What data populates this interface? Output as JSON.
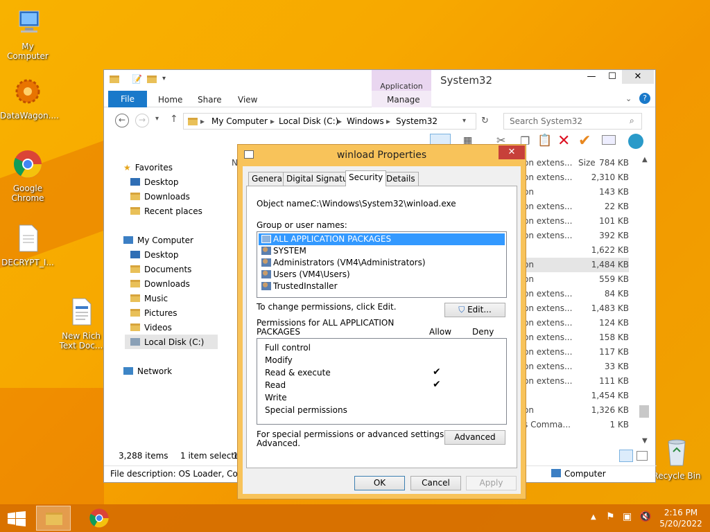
{
  "desktop": {
    "icons": [
      {
        "label": "My Computer"
      },
      {
        "label": "DataWagon...."
      },
      {
        "label": "Google Chrome"
      },
      {
        "label": "DECRYPT_I..."
      },
      {
        "label": "New Rich Text Doc..."
      },
      {
        "label": "Recycle Bin"
      }
    ]
  },
  "explorer": {
    "title": "System32",
    "context_tab": "Application Tools",
    "ribbon_tabs": [
      "File",
      "Home",
      "Share",
      "View",
      "Manage"
    ],
    "address": [
      "My Computer",
      "Local Disk (C:)",
      "Windows",
      "System32"
    ],
    "search_placeholder": "Search System32",
    "column_size": "Size",
    "nav": {
      "favorites": "Favorites",
      "fav_items": [
        "Desktop",
        "Downloads",
        "Recent places"
      ],
      "computer": "My Computer",
      "computer_items": [
        "Desktop",
        "Documents",
        "Downloads",
        "Music",
        "Pictures",
        "Videos",
        "Local Disk (C:)"
      ],
      "network": "Network"
    },
    "rows": [
      {
        "type": "on extens...",
        "size": "784 KB"
      },
      {
        "type": "on extens...",
        "size": "2,310 KB"
      },
      {
        "type": "on",
        "size": "143 KB"
      },
      {
        "type": "on extens...",
        "size": "22 KB"
      },
      {
        "type": "on extens...",
        "size": "101 KB"
      },
      {
        "type": "on extens...",
        "size": "392 KB"
      },
      {
        "type": "",
        "size": "1,622 KB"
      },
      {
        "type": "on",
        "size": "1,484 KB"
      },
      {
        "type": "on",
        "size": "559 KB"
      },
      {
        "type": "on extens...",
        "size": "84 KB"
      },
      {
        "type": "on extens...",
        "size": "1,483 KB"
      },
      {
        "type": "on extens...",
        "size": "124 KB"
      },
      {
        "type": "on extens...",
        "size": "158 KB"
      },
      {
        "type": "on extens...",
        "size": "117 KB"
      },
      {
        "type": "on extens...",
        "size": "33 KB"
      },
      {
        "type": "on extens...",
        "size": "111 KB"
      },
      {
        "type": "",
        "size": "1,454 KB"
      },
      {
        "type": "on",
        "size": "1,326 KB"
      },
      {
        "type": "s Comma...",
        "size": "1 KB"
      }
    ],
    "status_items": "3,288 items",
    "status_selected": "1 item selected",
    "status_selected_tail": "1",
    "description": "File description: OS Loader, Compa",
    "computer_label": "Computer"
  },
  "dialog": {
    "title": "winload Properties",
    "tabs": [
      "General",
      "Digital Signatures",
      "Security",
      "Details"
    ],
    "object_name_label": "Object name:",
    "object_name_value": "C:\\Windows\\System32\\winload.exe",
    "group_label": "Group or user names:",
    "users": [
      "ALL APPLICATION PACKAGES",
      "SYSTEM",
      "Administrators (VM4\\Administrators)",
      "Users (VM4\\Users)",
      "TrustedInstaller"
    ],
    "change_text": "To change permissions, click Edit.",
    "edit_btn": "Edit...",
    "perm_label_line1": "Permissions for ALL APPLICATION",
    "perm_label_line2": "PACKAGES",
    "allow": "Allow",
    "deny": "Deny",
    "permissions": [
      {
        "name": "Full control",
        "allow": false
      },
      {
        "name": "Modify",
        "allow": false
      },
      {
        "name": "Read & execute",
        "allow": true
      },
      {
        "name": "Read",
        "allow": true
      },
      {
        "name": "Write",
        "allow": false
      },
      {
        "name": "Special permissions",
        "allow": false
      }
    ],
    "special_text_line1": "For special permissions or advanced settings, click",
    "special_text_line2": "Advanced.",
    "advanced_btn": "Advanced",
    "ok": "OK",
    "cancel": "Cancel",
    "apply": "Apply"
  },
  "taskbar": {
    "time": "2:16 PM",
    "date": "5/20/2022"
  }
}
